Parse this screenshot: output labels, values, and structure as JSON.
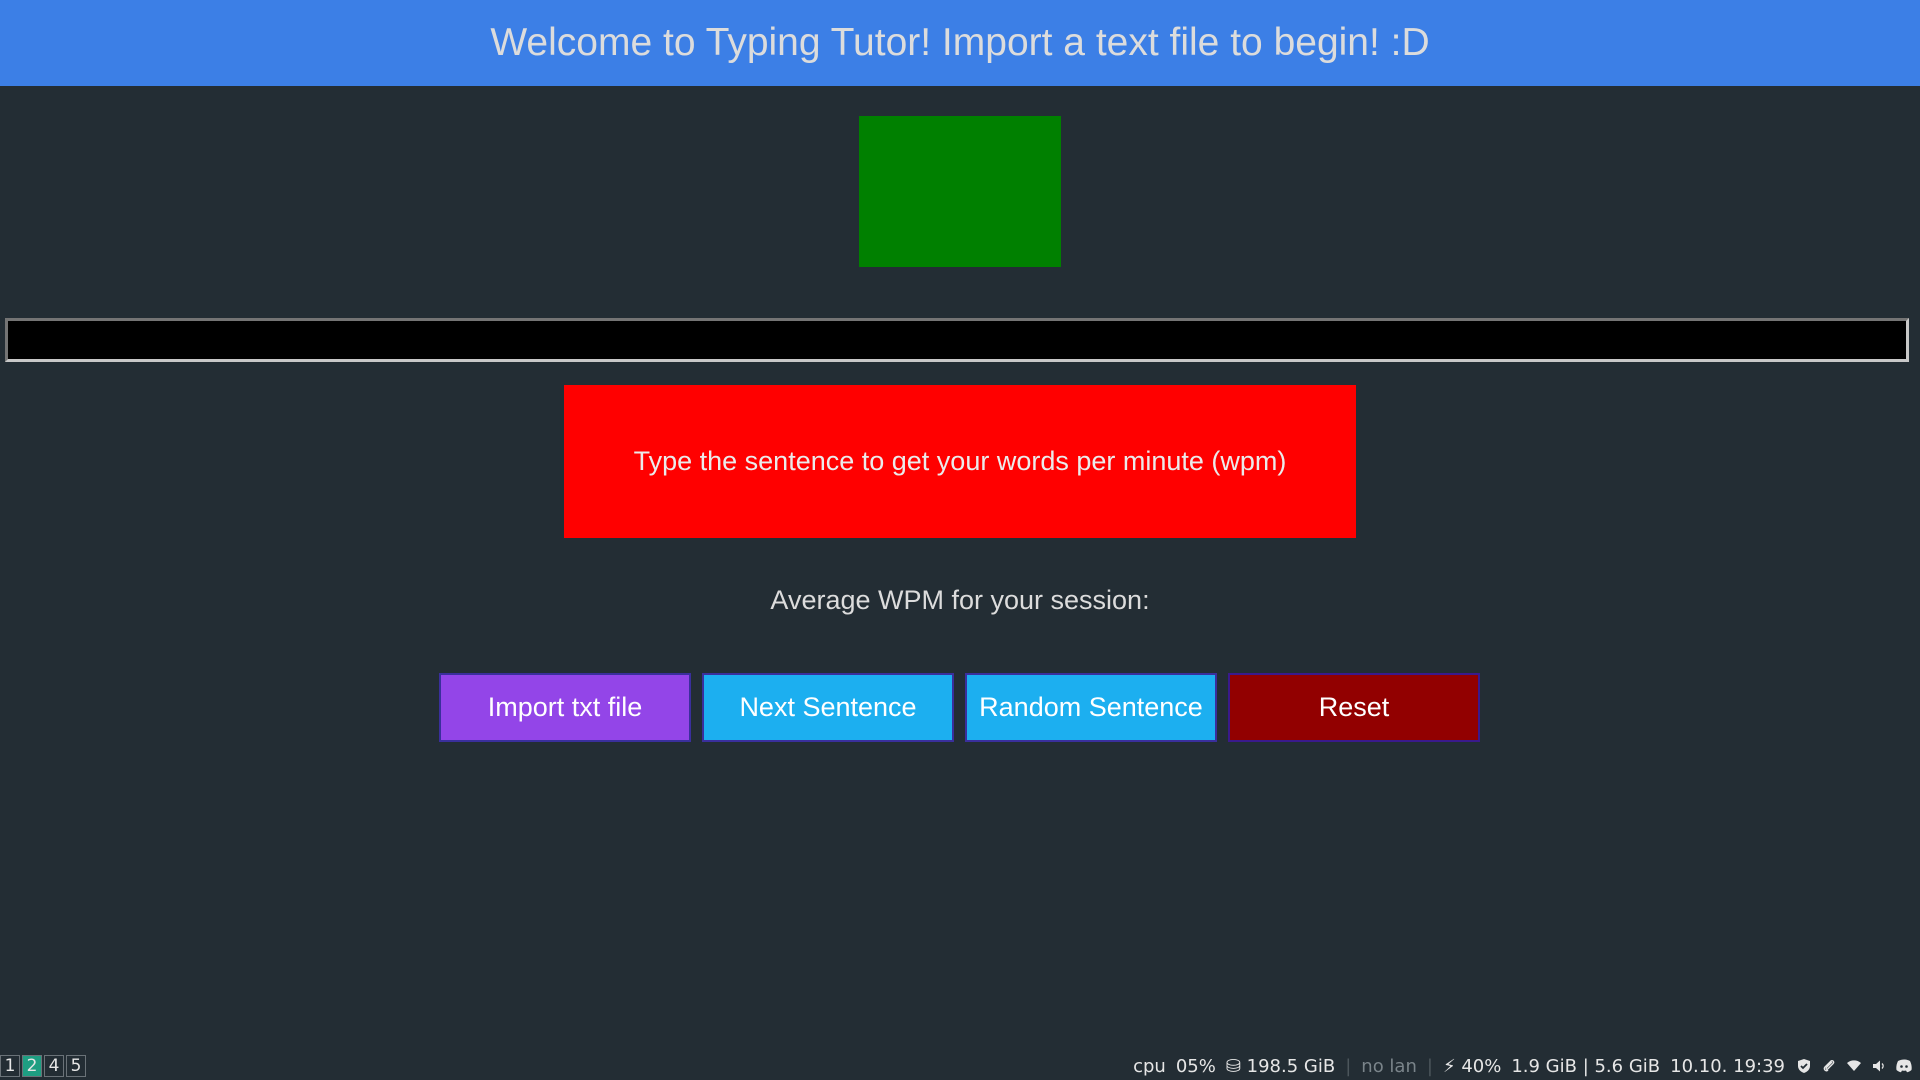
{
  "header": {
    "title": "Welcome to Typing Tutor! Import a text file to begin! :D"
  },
  "colors": {
    "header_bg": "#3c7fe6",
    "status_square": "#008000",
    "sentence_box": "#ff0000",
    "import_button": "#9345e8",
    "next_button": "#1caff0",
    "random_button": "#1caff0",
    "reset_button": "#920000"
  },
  "typing": {
    "input_value": ""
  },
  "sentence": {
    "prompt": "Type the sentence to get your words per minute (wpm)"
  },
  "session": {
    "avg_wpm_label": "Average WPM for your session:"
  },
  "buttons": {
    "import_label": "Import txt file",
    "next_label": "Next Sentence",
    "random_label": "Random Sentence",
    "reset_label": "Reset"
  },
  "taskbar": {
    "workspaces": [
      "1",
      "2",
      "4",
      "5"
    ],
    "active_workspace": "2",
    "cpu_label": "cpu",
    "cpu_value": "05%",
    "disk": "⛁ 198.5 GiB",
    "network": "no lan",
    "battery": "⚡ 40%",
    "memory": "1.9 GiB | 5.6 GiB",
    "datetime": "10.10. 19:39",
    "tray_icons": [
      "shield-icon",
      "paperclip-icon",
      "wifi-icon",
      "volume-icon",
      "discord-icon"
    ]
  }
}
